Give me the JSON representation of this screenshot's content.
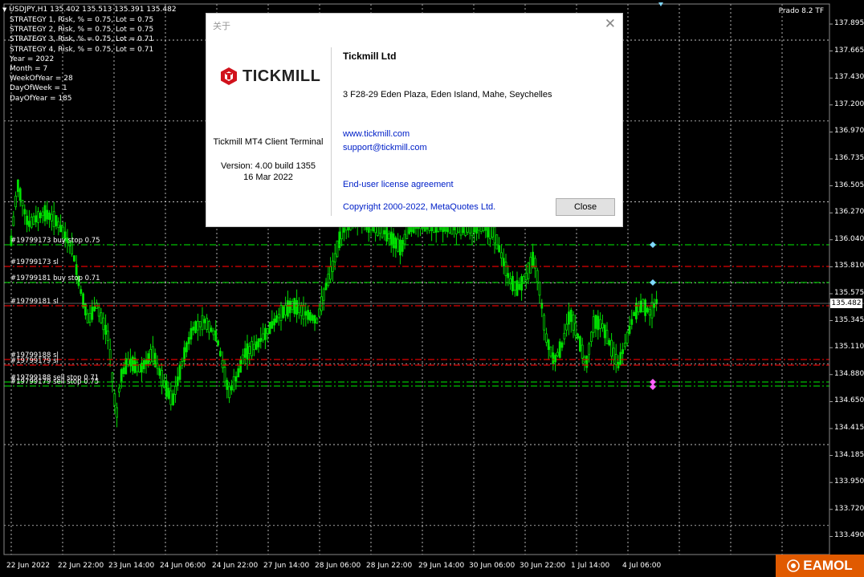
{
  "chart": {
    "symbol_line": "USDJPY,H1  135.402 135.513 135.391 135.482",
    "info_lines": [
      "STRATEGY 1, Risk, % = 0.75, Lot = 0.75",
      "STRATEGY 2, Risk, % = 0.75, Lot = 0.75",
      "STRATEGY 3, Risk, % = 0.75, Lot = 0.71",
      "STRATEGY 4, Risk, % = 0.75, Lot = 0.71",
      "Year = 2022",
      "Month = 7",
      "WeekOfYear = 28",
      "DayOfWeek = 1",
      "DayOfYear = 185"
    ],
    "indicator_label": "Prado 8.2 TF",
    "current_price": "135.482",
    "price_ticks": [
      "137.895",
      "137.665",
      "137.430",
      "137.200",
      "136.970",
      "136.735",
      "136.505",
      "136.270",
      "136.040",
      "135.810",
      "135.575",
      "135.345",
      "135.110",
      "134.880",
      "134.650",
      "134.415",
      "134.185",
      "133.950",
      "133.720",
      "133.490"
    ],
    "time_ticks": [
      "22 Jun 2022",
      "22 Jun 22:00",
      "23 Jun 14:00",
      "24 Jun 06:00",
      "24 Jun 22:00",
      "27 Jun 14:00",
      "28 Jun 06:00",
      "28 Jun 22:00",
      "29 Jun 14:00",
      "30 Jun 06:00",
      "30 Jun 22:00",
      "1 Jul 14:00",
      "4 Jul 06:00"
    ],
    "order_labels": [
      {
        "text": "#19799173 buy stop 0.75",
        "color": "green"
      },
      {
        "text": "#19799173 sl",
        "color": "red"
      },
      {
        "text": "#19799181 buy stop 0.71",
        "color": "green"
      },
      {
        "text": "#19799181 sl",
        "color": "red"
      },
      {
        "text": "#19799188 sl",
        "color": "red"
      },
      {
        "text": "#19799179 sl",
        "color": "red"
      },
      {
        "text": "#19799188 sell stop 0.71",
        "color": "green"
      },
      {
        "text": "#19799179 sell stop 0.75",
        "color": "green"
      }
    ],
    "colors": {
      "up": "#00e000",
      "down": "#00e000",
      "grid": "#ffffff",
      "green_line": "#00c000",
      "red_line": "#e00000",
      "marker_cyan": "#7fd8ff",
      "marker_pink": "#ff60ff"
    }
  },
  "dialog": {
    "title": "关于",
    "logo_text": "TICKMILL",
    "terminal_name": "Tickmill MT4 Client Terminal",
    "version": "Version: 4.00 build 1355",
    "build_date": "16 Mar 2022",
    "company": "Tickmill Ltd",
    "address": "3 F28-29 Eden Plaza, Eden Island, Mahe, Seychelles",
    "website": "www.tickmill.com",
    "support": "support@tickmill.com",
    "eula": "End-user license agreement",
    "copyright": "Copyright 2000-2022, MetaQuotes Ltd.",
    "close_label": "Close"
  },
  "watermark": {
    "text": "EAMOL"
  }
}
